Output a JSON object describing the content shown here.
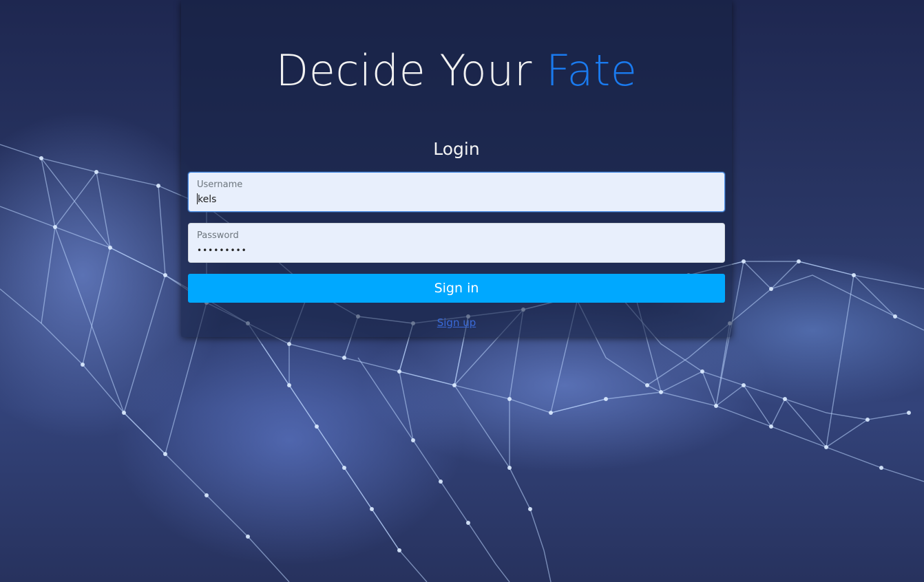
{
  "hero": {
    "title_main": "Decide Your",
    "title_accent": "Fate"
  },
  "form": {
    "heading": "Login",
    "username": {
      "label": "Username",
      "value": "kels"
    },
    "password": {
      "label": "Password",
      "masked_value": "•••••••••"
    },
    "submit_label": "Sign in",
    "signup_link": "Sign up"
  },
  "colors": {
    "accent_blue": "#1a7bf0",
    "button": "#00a8ff",
    "input_bg": "#e8effc"
  }
}
